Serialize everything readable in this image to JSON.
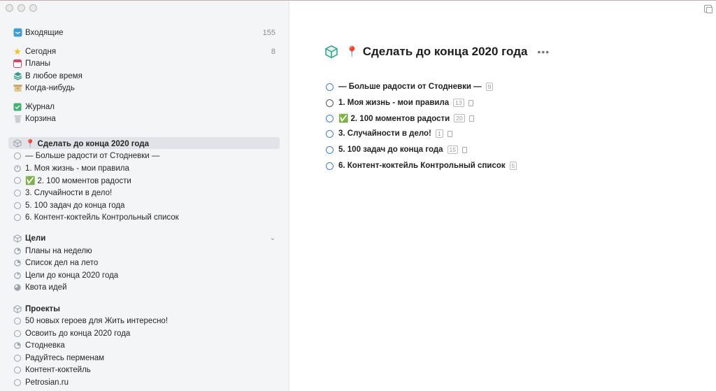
{
  "sidebar": {
    "inbox": {
      "label": "Входящие",
      "count": "155"
    },
    "today": {
      "label": "Сегодня",
      "count": "8"
    },
    "plans": {
      "label": "Планы"
    },
    "anytime": {
      "label": "В любое время"
    },
    "someday": {
      "label": "Когда-нибудь"
    },
    "logbook": {
      "label": "Журнал"
    },
    "trash": {
      "label": "Корзина"
    },
    "project_selected": {
      "label": "📍 Сделать до конца 2020 года"
    },
    "project_items": [
      "— Больше радости от Стодневки —",
      "1. Моя жизнь - мои правила",
      "✅ 2. 100 моментов радости",
      "3. Случайности в дело!",
      "5.  100 задач до конца года",
      "6. Контент-коктейль Контрольный список"
    ],
    "area_goals": {
      "label": "Цели"
    },
    "goals_items": [
      "Планы на неделю",
      "Список дел на лето",
      "Цели до конца 2020 года",
      "Квота идей"
    ],
    "area_projects": {
      "label": "Проекты"
    },
    "projects_items": [
      "50 новых героев для Жить интересно!",
      "Освоить до конца 2020 года",
      "Стодневка",
      "Радуйтесь перменам",
      "Контент-коктейль",
      "Petrosian.ru"
    ]
  },
  "main": {
    "title": "Сделать до конца 2020 года",
    "pin": "📍",
    "more": "•••",
    "tasks": [
      {
        "label": "— Больше радости от Стодневки —",
        "count": "9"
      },
      {
        "label": "1. Моя жизнь - мои правила",
        "count": "13"
      },
      {
        "label": "✅ 2. 100 моментов радости",
        "count": "20"
      },
      {
        "label": "3. Случайности в дело!",
        "count": "1"
      },
      {
        "label": "5.  100 задач до конца года",
        "count": "15"
      },
      {
        "label": "6. Контент-коктейль Контрольный список",
        "count": "5"
      }
    ]
  },
  "colors": {
    "accent": "#3f7ed6",
    "sidebar_bg": "#f4f5f7",
    "selected_bg": "#e1e3e8"
  }
}
